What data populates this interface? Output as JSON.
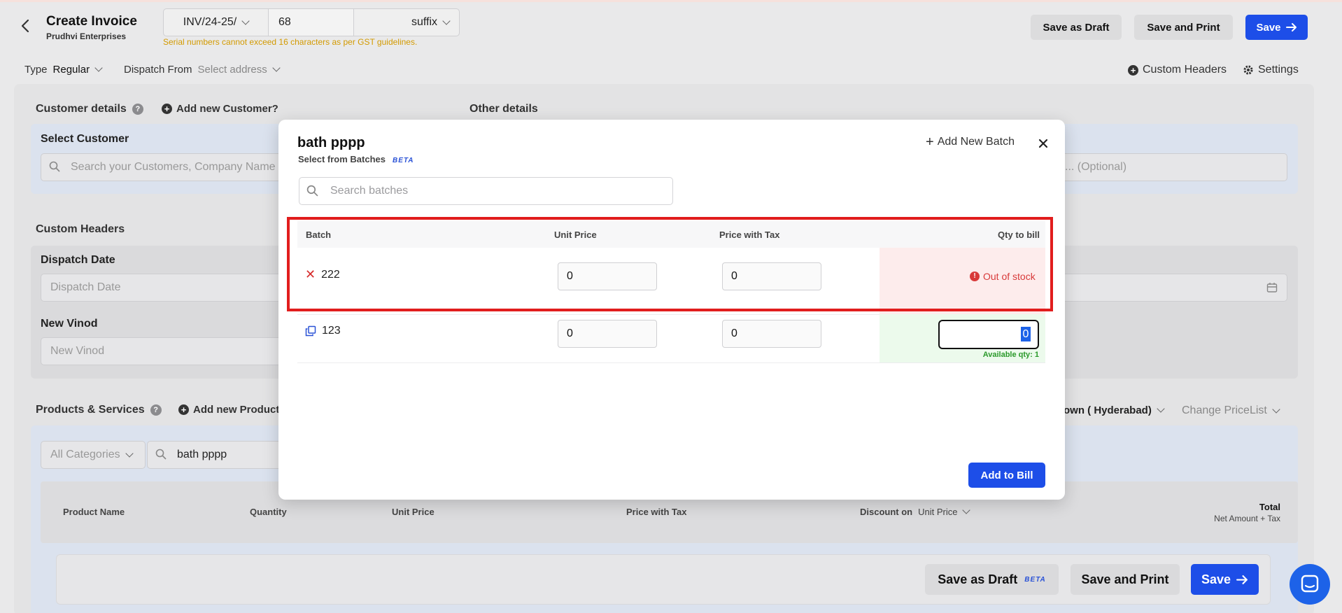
{
  "header": {
    "title": "Create Invoice",
    "company": "Prudhvi Enterprises",
    "serial_prefix": "INV/24-25/",
    "serial_number": "68",
    "serial_suffix": "suffix",
    "serial_warning": "Serial numbers cannot exceed 16 characters as per GST guidelines.",
    "save_draft": "Save as Draft",
    "save_print": "Save and Print",
    "save": "Save"
  },
  "options": {
    "type_label": "Type",
    "type_value": "Regular",
    "dispatch_label": "Dispatch From",
    "dispatch_value": "Select address",
    "custom_headers": "Custom Headers",
    "settings": "Settings"
  },
  "customer": {
    "section": "Customer details",
    "add_new": "Add new Customer?",
    "select_label": "Select Customer",
    "search_placeholder": "Search your Customers, Company Name",
    "other_details": "Other details",
    "other_placeholder": "c... (Optional)"
  },
  "custom_headers": {
    "section": "Custom Headers",
    "dispatch_date_label": "Dispatch Date",
    "dispatch_date_placeholder": "Dispatch Date",
    "new_vinod_label": "New Vinod",
    "new_vinod_placeholder": "New Vinod"
  },
  "products": {
    "section": "Products & Services",
    "add_new": "Add new Product?",
    "warehouse": "own ( Hyderabad)",
    "pricelist": "Change PriceList",
    "category": "All Categories",
    "search_value": "bath pppp",
    "columns": {
      "name": "Product Name",
      "qty": "Quantity",
      "unit_price": "Unit Price",
      "price_tax": "Price with Tax",
      "discount": "Discount on",
      "discount_value": "Unit Price",
      "total": "Total",
      "total_sub": "Net Amount + Tax"
    }
  },
  "bottom_bar": {
    "save_draft": "Save as Draft",
    "beta": "BETA",
    "save_print": "Save and Print",
    "save": "Save"
  },
  "modal": {
    "title": "bath pppp",
    "subtitle": "Select from Batches",
    "beta": "BETA",
    "add_batch": "Add New Batch",
    "search_placeholder": "Search batches",
    "columns": {
      "batch": "Batch",
      "unit_price": "Unit Price",
      "price_tax": "Price with Tax",
      "qty": "Qty to bill"
    },
    "rows": [
      {
        "batch": "222",
        "unit_price": "0",
        "price_tax": "0",
        "status": "Out of stock"
      },
      {
        "batch": "123",
        "unit_price": "0",
        "price_tax": "0",
        "qty": "0",
        "available": "Available qty: 1"
      }
    ],
    "add_to_bill": "Add to Bill"
  },
  "colors": {
    "primary": "#1d4ee8",
    "highlight": "#e11d1d",
    "out_of_stock": "#d83a3a",
    "available": "#2b9a2b"
  }
}
